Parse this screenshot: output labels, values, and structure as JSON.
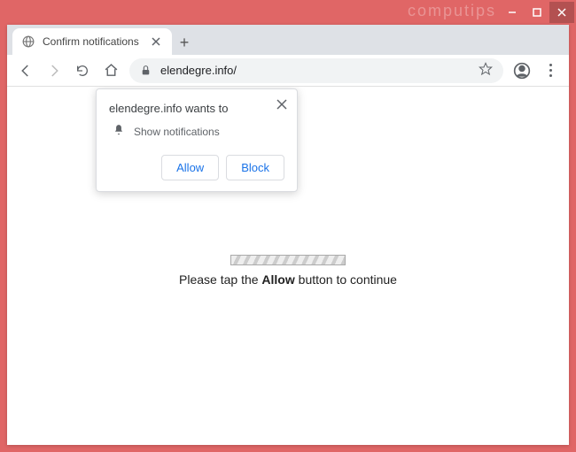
{
  "window": {
    "watermark": "computips"
  },
  "tab": {
    "title": "Confirm notifications"
  },
  "toolbar": {
    "url": "elendegre.info/"
  },
  "permission": {
    "title": "elendegre.info wants to",
    "item": "Show notifications",
    "allow": "Allow",
    "block": "Block"
  },
  "page": {
    "msg_pre": "Please tap the ",
    "msg_bold": "Allow",
    "msg_post": " button to continue"
  }
}
